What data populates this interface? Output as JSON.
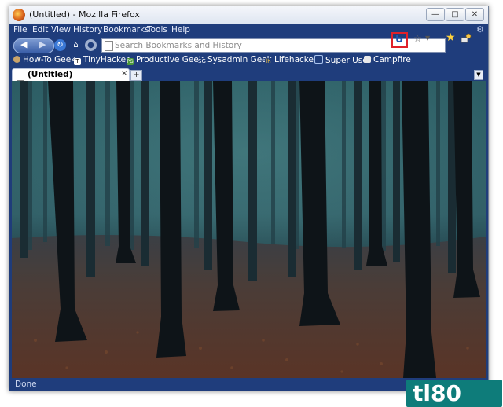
{
  "window": {
    "title": "(Untitled) - Mozilla Firefox",
    "controls": {
      "minimize": "—",
      "maximize": "□",
      "close": "✕"
    }
  },
  "menubar": {
    "items": [
      "File",
      "Edit",
      "View",
      "History",
      "Bookmarks",
      "Tools",
      "Help"
    ]
  },
  "navbar": {
    "url_placeholder": "Search Bookmarks and History"
  },
  "bookmarks": {
    "items": [
      "How-To Geek",
      "TinyHacker",
      "Productive Geek",
      "Sysadmin Geek",
      "Lifehacker",
      "Super User",
      "Campfire"
    ],
    "icons": [
      "howtogeek-icon",
      "tinyhacker-icon",
      "productivegeek-icon",
      "sysadmingeek-icon",
      "lifehacker-icon",
      "superuser-icon",
      "campfire-icon"
    ],
    "badges": [
      "",
      "T",
      "PG",
      "SG",
      "lh",
      "",
      ""
    ]
  },
  "tabs": {
    "items": [
      {
        "label": "(Untitled)",
        "close": "×"
      }
    ],
    "new_tab": "+"
  },
  "status": {
    "text": "Done"
  },
  "watermark": "tl80",
  "colors": {
    "chrome_blue": "#1f3d7c",
    "highlight": "#e0212a",
    "logo": "#0e7c7a"
  }
}
